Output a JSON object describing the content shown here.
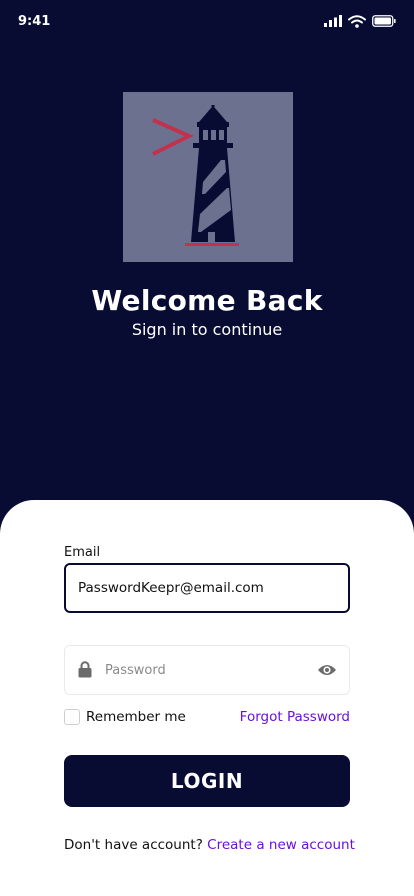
{
  "status_bar": {
    "time": "9:41",
    "icons": [
      "signal-icon",
      "wifi-icon",
      "battery-icon"
    ]
  },
  "logo": {
    "icon": "lighthouse-icon",
    "colors": {
      "background": "#6d7190",
      "tower": "#080c33",
      "accent": "#c0324e"
    }
  },
  "header": {
    "title": "Welcome Back",
    "subtitle": "Sign in to continue"
  },
  "form": {
    "email_label": "Email",
    "email_value": "PasswordKeepr@email.com",
    "password_placeholder": "Password",
    "password_value": "",
    "remember_label": "Remember me",
    "remember_checked": false,
    "forgot_label": "Forgot Password",
    "login_label": "LOGIN",
    "signup_prompt": "Don't have account?",
    "signup_link": "Create a new account"
  },
  "colors": {
    "background": "#080c33",
    "accent_link": "#6a0fe0",
    "card": "#ffffff"
  }
}
